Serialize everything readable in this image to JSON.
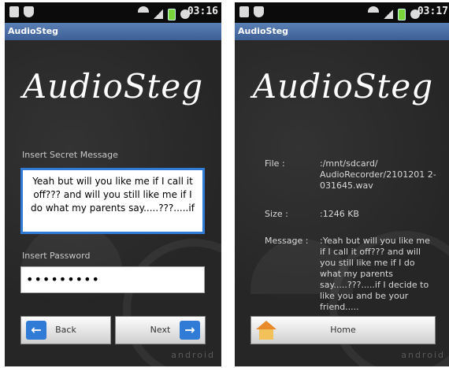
{
  "left": {
    "status": {
      "time": "03:16"
    },
    "app_title": "AudioSteg",
    "logo": "AudioSteg",
    "secret_label": "Insert Secret Message",
    "secret_text": "Yeah but will you like me if I call it off??? and will you still like me if I do what my parents say.....???.....if",
    "password_label": "Insert Password",
    "password_value": "•••••••••",
    "back_label": "Back",
    "next_label": "Next",
    "watermark": "android"
  },
  "right": {
    "status": {
      "time": "03:17"
    },
    "app_title": "AudioSteg",
    "logo": "AudioSteg",
    "file_key": "File :",
    "file_val": ":/mnt/sdcard/ AudioRecorder/2101201 2-031645.wav",
    "size_key": "Size :",
    "size_val": ":1246 KB",
    "message_key": "Message :",
    "message_val": ":Yeah but will you like me if I call it off??? and will you still like me if I do what my parents say.....???.....if I decide to like you and be your friend.....",
    "home_label": "Home",
    "watermark": "android"
  },
  "colors": {
    "accent": "#2f7bd6",
    "titlebar": "#4a6fa5",
    "background": "#262626"
  },
  "icons": [
    "sim-icon",
    "shield-icon",
    "wifi-icon",
    "signal-icon",
    "battery-icon",
    "alarm-icon",
    "back-arrow-icon",
    "next-arrow-icon",
    "home-icon"
  ]
}
